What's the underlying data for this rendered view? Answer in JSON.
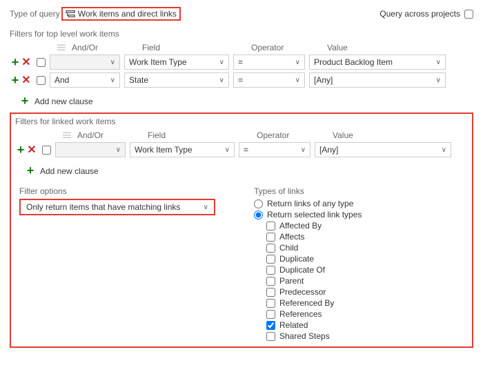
{
  "header": {
    "type_of_query_label": "Type of query",
    "query_type": "Work items and direct links",
    "cross_projects_label": "Query across projects"
  },
  "top": {
    "section_title": "Filters for top level work items",
    "col_andor": "And/Or",
    "col_field": "Field",
    "col_operator": "Operator",
    "col_value": "Value",
    "rows": [
      {
        "andor": "",
        "field": "Work Item Type",
        "op": "=",
        "val": "Product Backlog Item"
      },
      {
        "andor": "And",
        "field": "State",
        "op": "=",
        "val": "[Any]"
      }
    ],
    "add_clause": "Add new clause"
  },
  "linked": {
    "section_title": "Filters for linked work items",
    "col_andor": "And/Or",
    "col_field": "Field",
    "col_operator": "Operator",
    "col_value": "Value",
    "rows": [
      {
        "andor": "",
        "field": "Work Item Type",
        "op": "=",
        "val": "[Any]"
      }
    ],
    "add_clause": "Add new clause",
    "filter_options_label": "Filter options",
    "filter_options_value": "Only return items that have matching links",
    "types_of_links_label": "Types of links",
    "radio_any": "Return links of any type",
    "radio_selected": "Return selected link types",
    "linktypes": [
      {
        "label": "Affected By",
        "checked": false
      },
      {
        "label": "Affects",
        "checked": false
      },
      {
        "label": "Child",
        "checked": false
      },
      {
        "label": "Duplicate",
        "checked": false
      },
      {
        "label": "Duplicate Of",
        "checked": false
      },
      {
        "label": "Parent",
        "checked": false
      },
      {
        "label": "Predecessor",
        "checked": false
      },
      {
        "label": "Referenced By",
        "checked": false
      },
      {
        "label": "References",
        "checked": false
      },
      {
        "label": "Related",
        "checked": true
      },
      {
        "label": "Shared Steps",
        "checked": false
      }
    ]
  }
}
